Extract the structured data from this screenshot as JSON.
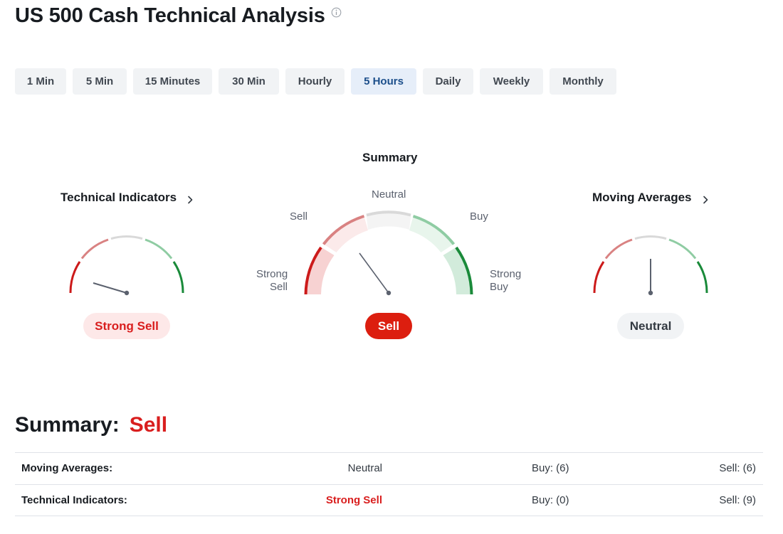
{
  "header": {
    "title": "US 500 Cash Technical Analysis",
    "info_icon": "info-circle-icon"
  },
  "timeframes": {
    "tabs": [
      {
        "label": "1 Min",
        "active": false
      },
      {
        "label": "5 Min",
        "active": false
      },
      {
        "label": "15 Minutes",
        "active": false
      },
      {
        "label": "30 Min",
        "active": false
      },
      {
        "label": "Hourly",
        "active": false
      },
      {
        "label": "5 Hours",
        "active": true
      },
      {
        "label": "Daily",
        "active": false
      },
      {
        "label": "Weekly",
        "active": false
      },
      {
        "label": "Monthly",
        "active": false
      }
    ]
  },
  "gauges": {
    "technical_indicators": {
      "heading": "Technical Indicators",
      "verdict": "Strong Sell",
      "level": "strong-sell"
    },
    "summary": {
      "heading": "Summary",
      "verdict": "Sell",
      "level": "sell",
      "scale_labels": {
        "strong_sell": [
          "Strong",
          "Sell"
        ],
        "sell": "Sell",
        "neutral": "Neutral",
        "buy": "Buy",
        "strong_buy": [
          "Strong",
          "Buy"
        ]
      }
    },
    "moving_averages": {
      "heading": "Moving Averages",
      "verdict": "Neutral",
      "level": "neutral"
    }
  },
  "summary": {
    "label": "Summary:",
    "verdict": "Sell",
    "rows": [
      {
        "name": "Moving Averages:",
        "value": "Neutral",
        "buy": "Buy: (6)",
        "sell": "Sell: (6)"
      },
      {
        "name": "Technical Indicators:",
        "value": "Strong Sell",
        "buy": "Buy: (0)",
        "sell": "Sell: (9)"
      }
    ]
  },
  "colors": {
    "strong_sell": "#cc1a1a",
    "sell": "#d98282",
    "neutral": "#d9d9d9",
    "buy": "#8fcca3",
    "strong_buy": "#1a8a3a",
    "needle": "#5b616e",
    "sell_red": "#d91e1e",
    "active_tab_bg": "#e6eef9",
    "active_tab_text": "#1c4f8b"
  }
}
